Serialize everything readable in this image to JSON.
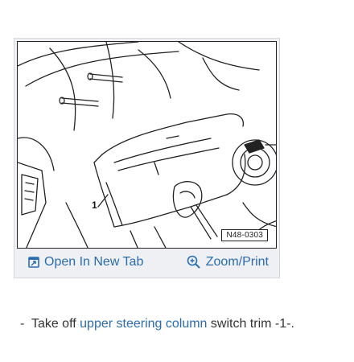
{
  "figure": {
    "label": "N48-0303",
    "callout": "1"
  },
  "actions": {
    "open_new_tab": "Open In New Tab",
    "zoom_print": "Zoom/Print"
  },
  "instruction": {
    "bullet": "-",
    "before": "Take off",
    "link": "upper steering column",
    "after": "switch trim -1-."
  },
  "icons": {
    "open_new_tab": "open-new-tab-icon",
    "zoom": "zoom-icon"
  },
  "colors": {
    "link": "#2b6cb0",
    "card_bg": "#eef0f3"
  }
}
